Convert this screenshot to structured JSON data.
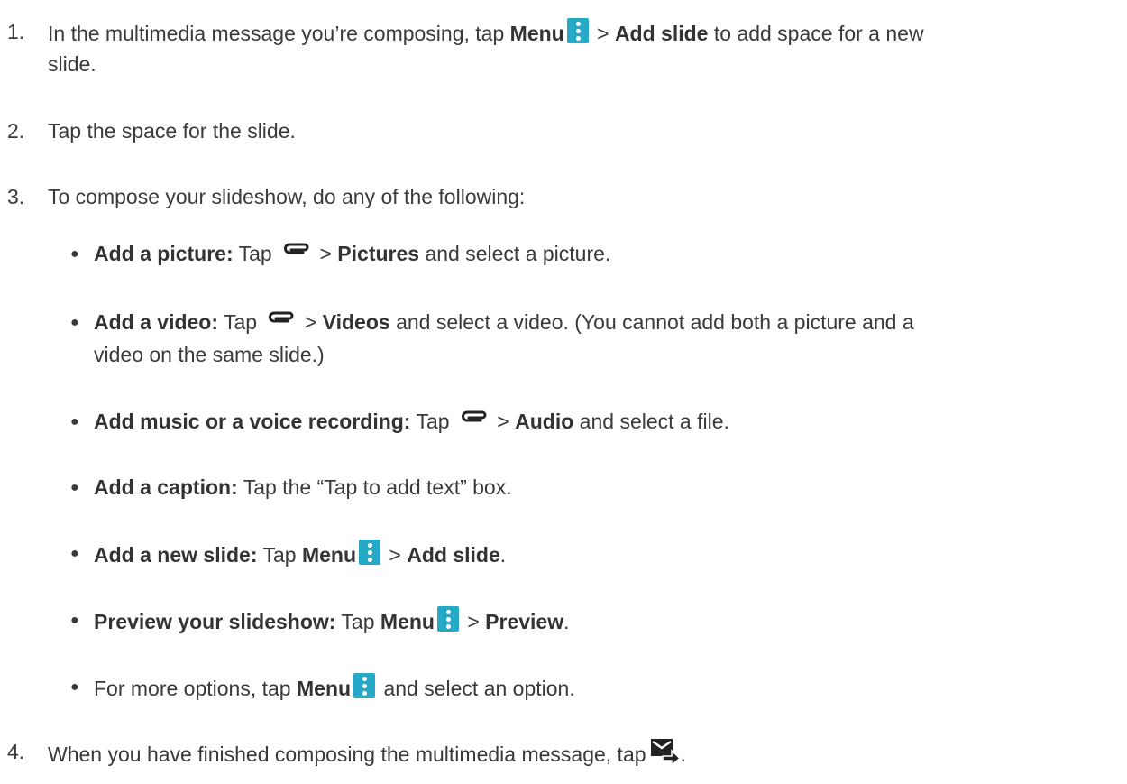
{
  "steps": [
    {
      "number": "1.",
      "line1_a": "In the multimedia message you’re composing, tap ",
      "line1_b": "Menu",
      "line1_c": " > ",
      "line1_d": "Add slide",
      "line1_e": " to add space for a new",
      "line2": "slide."
    },
    {
      "number": "2.",
      "text": "Tap the space for the slide."
    },
    {
      "number": "3.",
      "text": "To compose your slideshow, do any of the following:"
    },
    {
      "number": "4.",
      "text": "When you have finished composing the multimedia message, tap",
      "end": "."
    }
  ],
  "bullets": {
    "picture": {
      "label": "Add a picture:",
      "a": " Tap ",
      "b": " > ",
      "c": "Pictures",
      "d": " and select a picture."
    },
    "video": {
      "label": "Add a video:",
      "a": " Tap ",
      "b": " > ",
      "c": "Videos",
      "d": " and select a video. (You cannot add both a picture and a",
      "line2": "video on the same slide.)"
    },
    "music": {
      "label": "Add music or a voice recording:",
      "a": " Tap ",
      "b": " > ",
      "c": "Audio",
      "d": " and select a file."
    },
    "caption": {
      "label": "Add a caption:",
      "a": " Tap the “Tap to add text” box."
    },
    "new_slide": {
      "label": "Add a new slide:",
      "a": " Tap ",
      "b": "Menu",
      "c": " > ",
      "d": "Add slide",
      "e": "."
    },
    "preview": {
      "label": "Preview your slideshow:",
      "a": " Tap ",
      "b": "Menu",
      "c": " > ",
      "d": "Preview",
      "e": "."
    },
    "more": {
      "a": "For more options, tap ",
      "b": "Menu",
      "c": " and select an option."
    }
  },
  "bullet_char": "●",
  "colors": {
    "text": "#3a3a3a",
    "menu_icon_bg": "#26a8c7",
    "icon_dark": "#222222"
  },
  "icons": {
    "menu": "menu-overflow-icon",
    "attach": "paperclip-icon",
    "send": "send-mms-icon"
  }
}
